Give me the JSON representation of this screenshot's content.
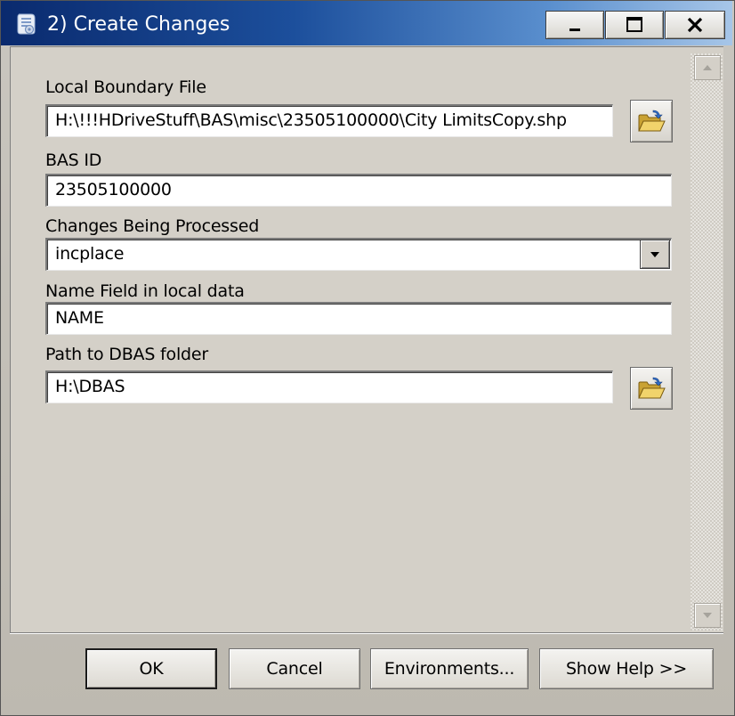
{
  "window": {
    "title": "2) Create Changes"
  },
  "titlebar_buttons": {
    "minimize": "minimize",
    "maximize": "maximize",
    "close": "close"
  },
  "form": {
    "local_boundary_file": {
      "label": "Local Boundary File",
      "value": "H:\\!!!HDriveStuff\\BAS\\misc\\23505100000\\City LimitsCopy.shp"
    },
    "bas_id": {
      "label": "BAS ID",
      "value": "23505100000"
    },
    "changes_processed": {
      "label": "Changes Being Processed",
      "value": "incplace"
    },
    "name_field": {
      "label": "Name Field in local data",
      "value": "NAME"
    },
    "dbas_path": {
      "label": "Path to DBAS folder",
      "value": "H:\\DBAS"
    }
  },
  "buttons": {
    "ok": "OK",
    "cancel": "Cancel",
    "environments": "Environments...",
    "show_help": "Show Help >>"
  },
  "colors": {
    "titlebar_start": "#0a2a6e",
    "titlebar_end": "#a7c6e8",
    "dialog_bg": "#d4d0c8",
    "folder_yellow": "#e8c24a"
  }
}
